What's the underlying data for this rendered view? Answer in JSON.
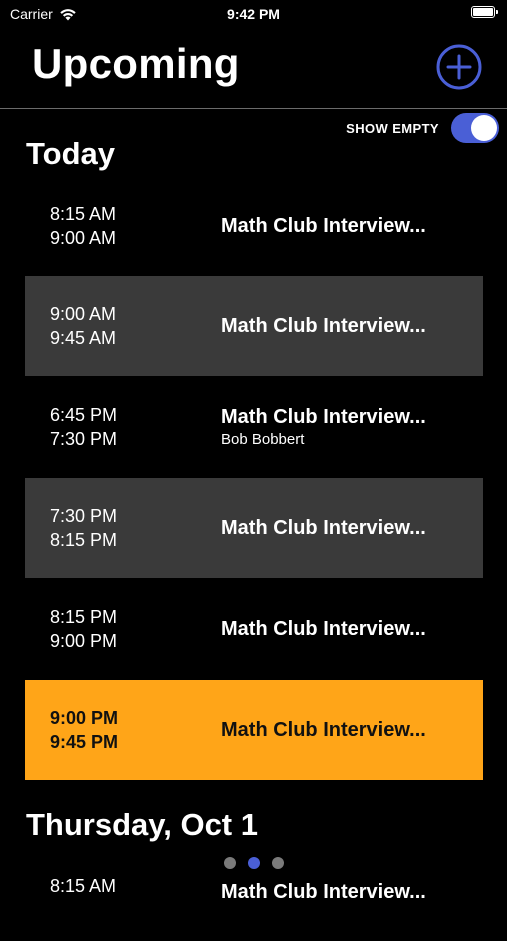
{
  "status_bar": {
    "carrier": "Carrier",
    "time": "9:42 PM"
  },
  "header": {
    "title": "Upcoming",
    "add_icon": "plus-circle-icon"
  },
  "toggle": {
    "label": "SHOW EMPTY",
    "on": true
  },
  "colors": {
    "accent": "#4a5fd6",
    "alt_row": "#3a3a3a",
    "highlight_row": "#ffa518",
    "background": "#000000"
  },
  "sections": [
    {
      "heading": "Today",
      "events": [
        {
          "start": "8:15 AM",
          "end": "9:00 AM",
          "title": "Math Club Interview...",
          "subtitle": ""
        },
        {
          "start": "9:00 AM",
          "end": "9:45 AM",
          "title": "Math Club Interview...",
          "subtitle": ""
        },
        {
          "start": "6:45 PM",
          "end": "7:30 PM",
          "title": "Math Club Interview...",
          "subtitle": "Bob Bobbert"
        },
        {
          "start": "7:30 PM",
          "end": "8:15 PM",
          "title": "Math Club Interview...",
          "subtitle": ""
        },
        {
          "start": "8:15 PM",
          "end": "9:00 PM",
          "title": "Math Club Interview...",
          "subtitle": ""
        },
        {
          "start": "9:00 PM",
          "end": "9:45 PM",
          "title": "Math Club Interview...",
          "subtitle": ""
        }
      ]
    },
    {
      "heading": "Thursday, Oct 1",
      "events": [
        {
          "start": "8:15 AM",
          "title": "Math Club Interview..."
        }
      ]
    }
  ],
  "page_indicator": {
    "count": 3,
    "active": 2
  }
}
